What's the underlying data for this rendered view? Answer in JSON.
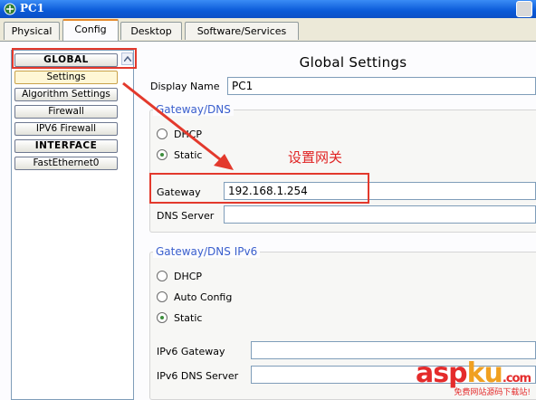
{
  "window": {
    "title": "PC1"
  },
  "tabs": [
    {
      "label": "Physical"
    },
    {
      "label": "Config"
    },
    {
      "label": "Desktop"
    },
    {
      "label": "Software/Services"
    }
  ],
  "sidebar": {
    "items": [
      {
        "label": "GLOBAL"
      },
      {
        "label": "Settings"
      },
      {
        "label": "Algorithm Settings"
      },
      {
        "label": "Firewall"
      },
      {
        "label": "IPV6 Firewall"
      },
      {
        "label": "INTERFACE"
      },
      {
        "label": "FastEthernet0"
      }
    ]
  },
  "main": {
    "title": "Global Settings",
    "display_name_label": "Display Name",
    "display_name_value": "PC1",
    "gateway_section": {
      "title": "Gateway/DNS",
      "dhcp_label": "DHCP",
      "static_label": "Static",
      "gateway_label": "Gateway",
      "gateway_value": "192.168.1.254",
      "dns_label": "DNS Server",
      "dns_value": ""
    },
    "ipv6_section": {
      "title": "Gateway/DNS IPv6",
      "dhcp_label": "DHCP",
      "auto_label": "Auto Config",
      "static_label": "Static",
      "gateway_label": "IPv6 Gateway",
      "gateway_value": "",
      "dns_label": "IPv6 DNS Server",
      "dns_value": ""
    }
  },
  "annotation": {
    "text": "设置网关"
  },
  "watermark": {
    "a": "asp",
    "b": "ku",
    "c": ".com",
    "sub": "免费网站源码下载站!"
  },
  "colors": {
    "highlight": "#e3392c",
    "section_title": "#3a5fcd",
    "tab_active": "#e68b2c"
  }
}
